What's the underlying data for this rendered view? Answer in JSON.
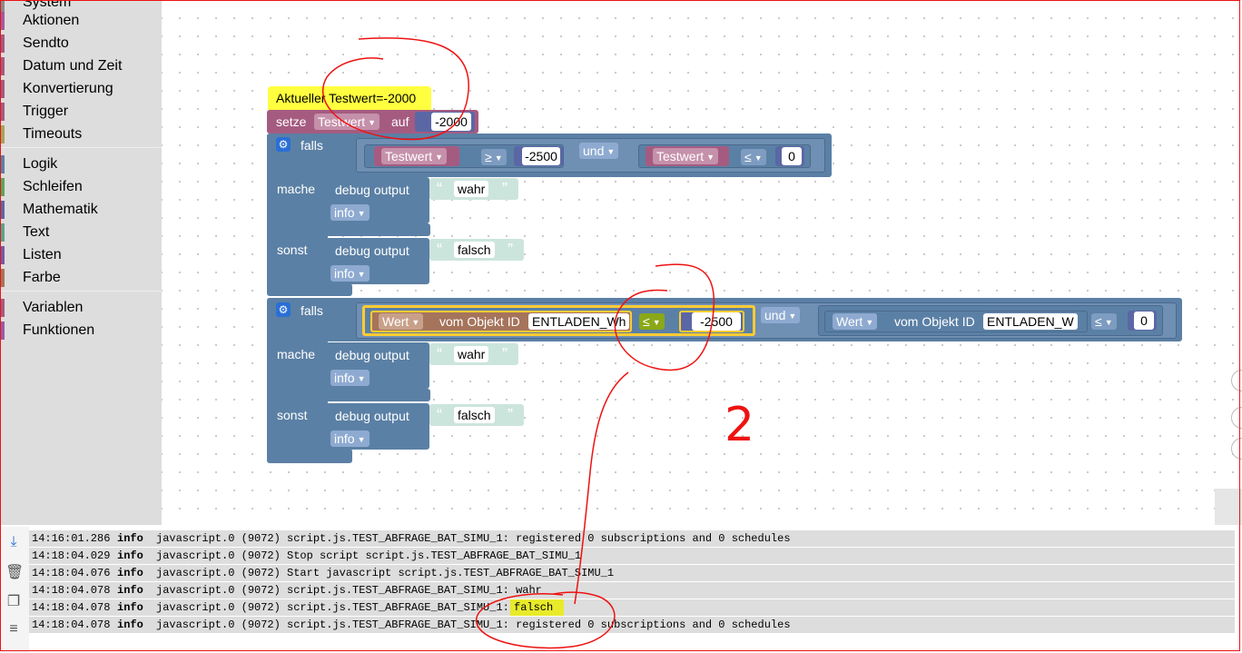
{
  "sidebar": {
    "categories": [
      {
        "label": "System",
        "color": "#8a8a8a"
      },
      {
        "label": "Aktionen",
        "color": "#a55b9a"
      },
      {
        "label": "Sendto",
        "color": "#a55b80"
      },
      {
        "label": "Datum und Zeit",
        "color": "#a55b80"
      },
      {
        "label": "Konvertierung",
        "color": "#a55b80"
      },
      {
        "label": "Trigger",
        "color": "#a55b80"
      },
      {
        "label": "Timeouts",
        "color": "#a5a55b"
      },
      {
        "label": "Logik",
        "color": "#5b80a5"
      },
      {
        "label": "Schleifen",
        "color": "#5ba55b"
      },
      {
        "label": "Mathematik",
        "color": "#5b67a5"
      },
      {
        "label": "Text",
        "color": "#5ba58c"
      },
      {
        "label": "Listen",
        "color": "#745ba5"
      },
      {
        "label": "Farbe",
        "color": "#a5745b"
      },
      {
        "label": "Variablen",
        "color": "#a55b80"
      },
      {
        "label": "Funktionen",
        "color": "#995ba5"
      }
    ]
  },
  "blocks": {
    "comment": "Aktueller Testwert=-2000",
    "set": {
      "label": "setze",
      "var": "Testwert",
      "auf": "auf",
      "value": "-2000"
    },
    "if1": {
      "falls": "falls",
      "mache": "mache",
      "sonst": "sonst",
      "left_var": "Testwert",
      "op1": "≥",
      "val1": "-2500",
      "and": "und",
      "right_var": "Testwert",
      "op2": "≤",
      "val2": "0",
      "then_debug": "debug output",
      "then_text": "wahr",
      "then_level": "info",
      "else_debug": "debug output",
      "else_text": "falsch",
      "else_level": "info"
    },
    "if2": {
      "falls": "falls",
      "mache": "mache",
      "sonst": "sonst",
      "l_wert": "Wert",
      "l_vom": "vom Objekt ID",
      "l_id": "ENTLADEN_Wh",
      "op1": "≤",
      "val1": "-2500",
      "and": "und",
      "r_wert": "Wert",
      "r_vom": "vom Objekt ID",
      "r_id": "ENTLADEN_W",
      "op2": "≤",
      "val2": "0",
      "then_debug": "debug output",
      "then_text": "wahr",
      "then_level": "info",
      "else_debug": "debug output",
      "else_text": "falsch",
      "else_level": "info"
    }
  },
  "log": {
    "rows": [
      {
        "time": "14:16:01.286",
        "level": "info",
        "msg": "javascript.0 (9072) script.js.TEST_ABFRAGE_BAT_SIMU_1: registered 0 subscriptions and 0 schedules",
        "hl": ""
      },
      {
        "time": "14:18:04.029",
        "level": "info",
        "msg": "javascript.0 (9072) Stop script script.js.TEST_ABFRAGE_BAT_SIMU_1",
        "hl": ""
      },
      {
        "time": "14:18:04.076",
        "level": "info",
        "msg": "javascript.0 (9072) Start javascript script.js.TEST_ABFRAGE_BAT_SIMU_1",
        "hl": ""
      },
      {
        "time": "14:18:04.078",
        "level": "info",
        "msg": "javascript.0 (9072) script.js.TEST_ABFRAGE_BAT_SIMU_1: wahr",
        "hl": ""
      },
      {
        "time": "14:18:04.078",
        "level": "info",
        "msg": "javascript.0 (9072) script.js.TEST_ABFRAGE_BAT_SIMU_1: ",
        "hl": "falsch"
      },
      {
        "time": "14:18:04.078",
        "level": "info",
        "msg": "javascript.0 (9072) script.js.TEST_ABFRAGE_BAT_SIMU_1: registered 0 subscriptions and 0 schedules",
        "hl": ""
      }
    ]
  },
  "annotation": {
    "text": "2"
  },
  "colors": {
    "logic": "#5b80a5",
    "variable": "#a55b80",
    "math": "#5b67a5",
    "text": "#5ba58c",
    "object": "#a5745b",
    "highlight": "#ffff3f",
    "selected": "#fc3"
  }
}
